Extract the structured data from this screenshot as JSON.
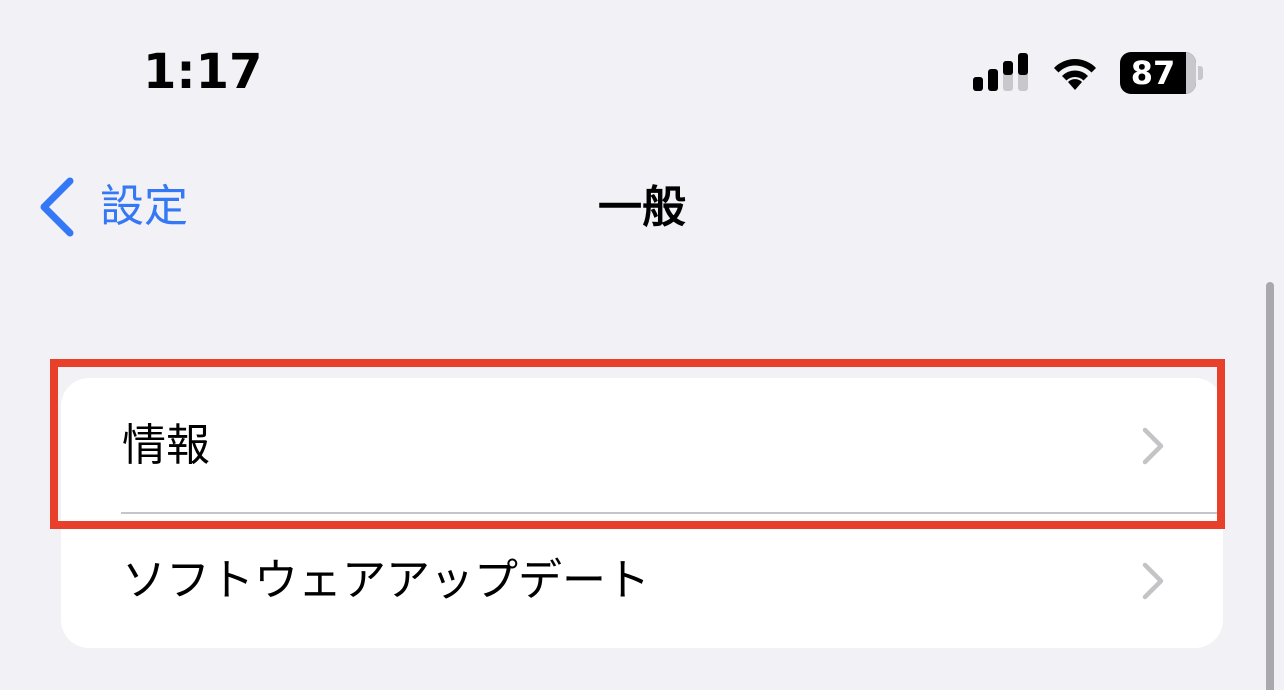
{
  "status_bar": {
    "time": "1:17",
    "battery_level": "87",
    "signal_icon": "cellular-signal-icon",
    "wifi_icon": "wifi-icon"
  },
  "nav": {
    "back_label": "設定",
    "title": "一般",
    "back_icon": "chevron-left-icon"
  },
  "list": {
    "items": [
      {
        "label": "情報",
        "icon": "chevron-right-icon"
      },
      {
        "label": "ソフトウェアアップデート",
        "icon": "chevron-right-icon"
      }
    ]
  },
  "colors": {
    "background": "#f1f1f6",
    "accent": "#3478f6",
    "highlight": "#e8402b",
    "chevron": "#c4c4c7"
  }
}
